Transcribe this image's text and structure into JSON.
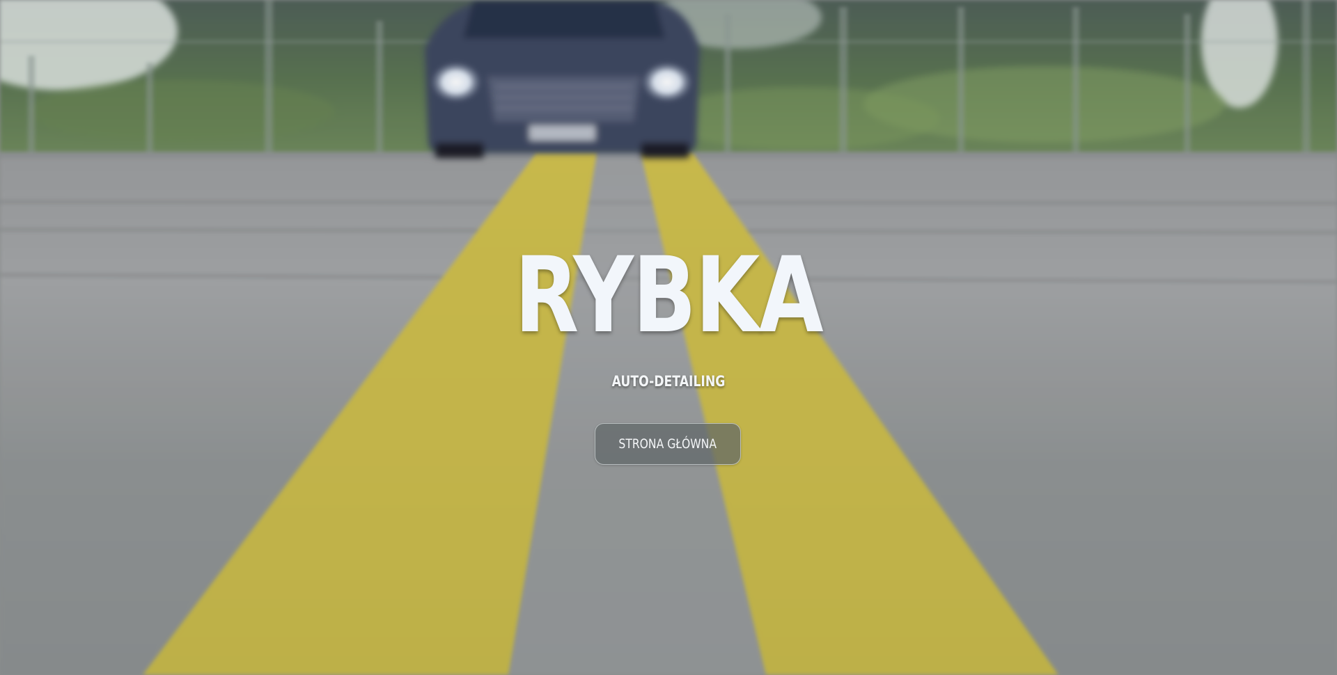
{
  "hero": {
    "title": "RYBKA",
    "subtitle": "AUTO-DETAILING",
    "button_label": "STRONA GŁÓWNA",
    "background_image": "blurred road with double yellow center lines and a dark car approaching in the distance"
  },
  "colors": {
    "title_text": "#f2f6fb",
    "road_gray": "#8e9292",
    "lane_yellow": "#c9bd4c",
    "button_bg": "#5f6668"
  }
}
